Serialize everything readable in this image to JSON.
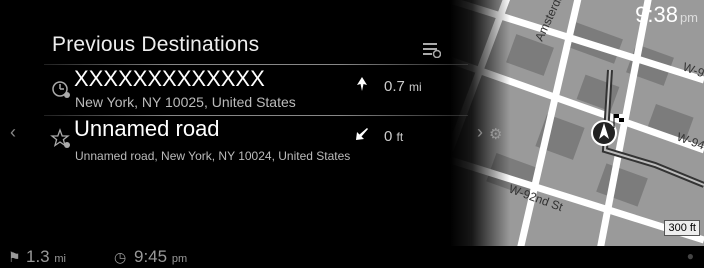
{
  "clock": {
    "time": "9:38",
    "ampm": "pm"
  },
  "header": {
    "title": "Previous Destinations"
  },
  "destinations": [
    {
      "name": "XXXXXXXXXXXXX",
      "address": "New York, NY 10025, United States",
      "direction": "up-arrow",
      "distance": "0.7",
      "unit": "mi"
    },
    {
      "name": "Unnamed road",
      "address": "Unnamed road, New York, NY 10024, United States",
      "direction": "down-left-arrow",
      "distance": "0",
      "unit": "ft"
    }
  ],
  "map": {
    "streets": [
      "Amsterdam",
      "W-9",
      "W-94",
      "W-92nd St"
    ],
    "scale": "300 ft"
  },
  "status": {
    "remaining": "1.3",
    "remaining_unit": "mi",
    "eta": "9:45",
    "eta_ampm": "pm"
  },
  "icons": {
    "list_sort": "list-sort-icon",
    "history": "history-icon",
    "favorite": "favorite-icon",
    "settings": "gear-icon",
    "flag": "flag-icon",
    "eta": "clock-icon",
    "bluetooth": "bluetooth-icon"
  },
  "colors": {
    "background": "#000000",
    "map_road": "#ffffff",
    "route": "#3a3a3a"
  }
}
